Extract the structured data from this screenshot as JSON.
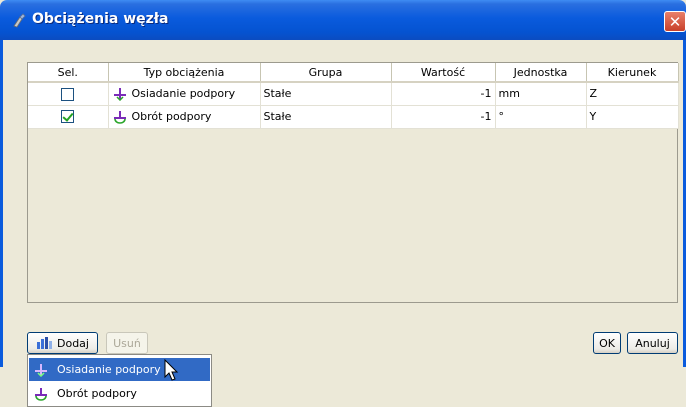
{
  "window": {
    "title": "Obciążenia węzła",
    "close_symbol": "✕"
  },
  "grid": {
    "columns": [
      "Sel.",
      "Typ obciążenia",
      "Grupa",
      "Wartość",
      "Jednostka",
      "Kierunek"
    ],
    "rows": [
      {
        "selected": false,
        "type": "Osiadanie podpory",
        "icon": "support-settlement-icon",
        "group": "Stałe",
        "value": "-1",
        "unit": "mm",
        "direction": "Z"
      },
      {
        "selected": true,
        "type": "Obrót podpory",
        "icon": "support-rotation-icon",
        "group": "Stałe",
        "value": "-1",
        "unit": "°",
        "direction": "Y"
      }
    ]
  },
  "buttons": {
    "add": "Dodaj",
    "remove": "Usuń",
    "ok": "OK",
    "cancel": "Anuluj"
  },
  "add_menu": {
    "items": [
      {
        "label": "Osiadanie podpory",
        "icon": "support-settlement-icon",
        "highlighted": true
      },
      {
        "label": "Obrót podpory",
        "icon": "support-rotation-icon",
        "highlighted": false
      }
    ]
  },
  "colors": {
    "titlebar": "#0A5BDD",
    "selection": "#316AC5",
    "checkmark": "#21A121"
  }
}
